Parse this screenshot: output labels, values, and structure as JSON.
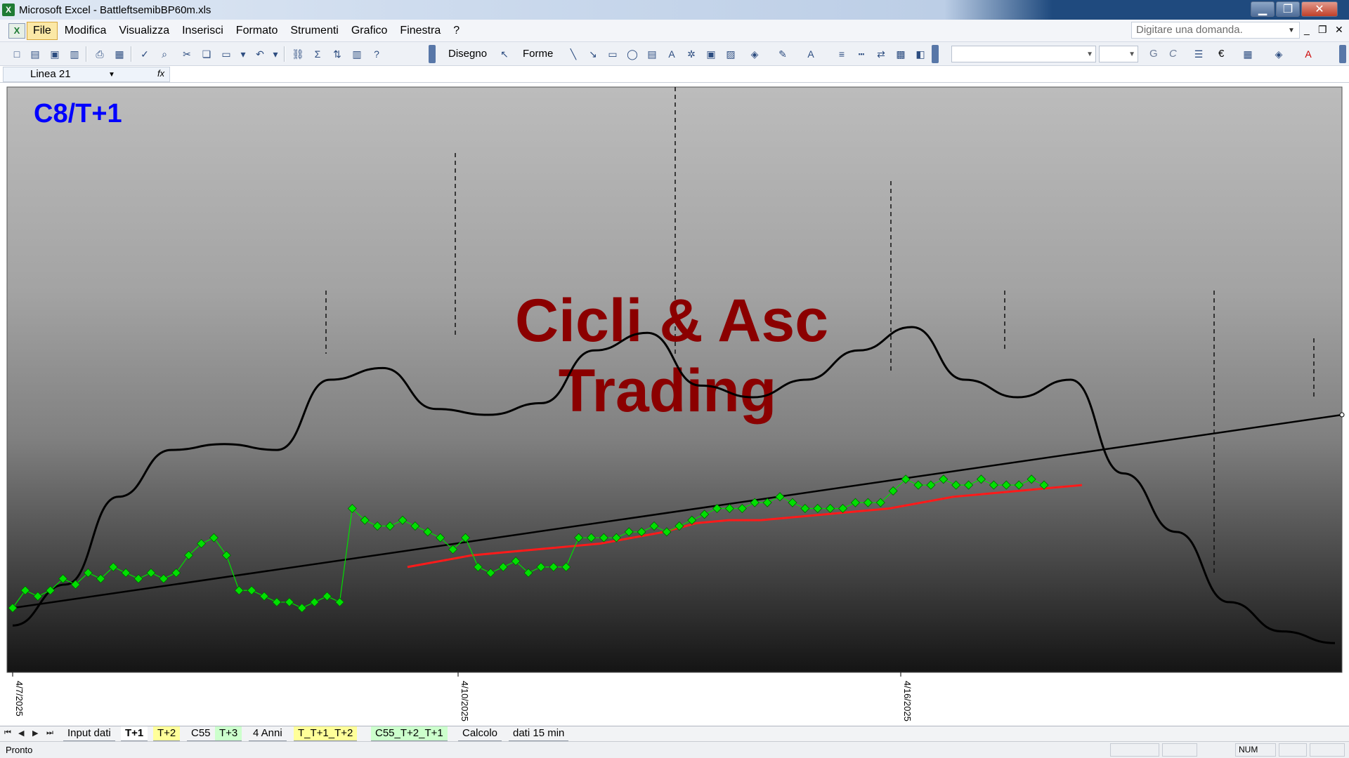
{
  "window": {
    "app_title": "Microsoft Excel - BattleftsemibBP60m.xls",
    "app_icon": "X",
    "min_label": "▁",
    "max_label": "❐",
    "close_label": "✕"
  },
  "menu": {
    "items": [
      "File",
      "Modifica",
      "Visualizza",
      "Inserisci",
      "Formato",
      "Strumenti",
      "Grafico",
      "Finestra",
      "?"
    ],
    "active_item": "File",
    "ask_placeholder": "Digitare una domanda."
  },
  "toolbar": {
    "drawing_label": "Disegno",
    "shapes_label": "Forme",
    "bold_label": "G",
    "italic_label": "C",
    "euro_label": "€"
  },
  "formula_bar": {
    "name_box": "Linea 21",
    "fx_label": "fx"
  },
  "chart": {
    "watermark_line1": "Cicli & Asc",
    "watermark_line2": "Trading",
    "label": "C8/T+1",
    "label_color": "#0000ff",
    "watermark_color": "#8b0000",
    "price_color": "#00e000",
    "ma_color": "#ff1a1a",
    "cycle_color": "#000000",
    "x_tick_labels": [
      "4/7/2025",
      "4/10/2025",
      "4/16/2025"
    ]
  },
  "chart_data": {
    "type": "line",
    "title": "C8/T+1",
    "xlabel": "",
    "ylabel": "",
    "x_ticks": [
      "4/7/2025",
      "4/10/2025",
      "4/16/2025"
    ],
    "grid": false,
    "series": [
      {
        "values": [
          0.11,
          0.14,
          0.13,
          0.14,
          0.16,
          0.15,
          0.17,
          0.16,
          0.18,
          0.17,
          0.16,
          0.17,
          0.16,
          0.17,
          0.2,
          0.22,
          0.23,
          0.2,
          0.14,
          0.14,
          0.13,
          0.12,
          0.12,
          0.11,
          0.12,
          0.13,
          0.12,
          0.28,
          0.26,
          0.25,
          0.25,
          0.26,
          0.25,
          0.24,
          0.23,
          0.21,
          0.23,
          0.18,
          0.17,
          0.18,
          0.19,
          0.17,
          0.18,
          0.18,
          0.18,
          0.23,
          0.23,
          0.23,
          0.23,
          0.24,
          0.24,
          0.25,
          0.24,
          0.25,
          0.26,
          0.27,
          0.28,
          0.28,
          0.28,
          0.29,
          0.29,
          0.3,
          0.29,
          0.28,
          0.28,
          0.28,
          0.28,
          0.29,
          0.29,
          0.29,
          0.31,
          0.33,
          0.32,
          0.32,
          0.33,
          0.32,
          0.32,
          0.33,
          0.32,
          0.32,
          0.32,
          0.33,
          0.32
        ]
      },
      {
        "values": [
          0.18,
          0.19,
          0.2,
          0.205,
          0.21,
          0.215,
          0.22,
          0.23,
          0.24,
          0.255,
          0.26,
          0.26,
          0.265,
          0.27,
          0.275,
          0.28,
          0.29,
          0.3,
          0.305,
          0.31,
          0.315,
          0.32
        ]
      },
      {
        "values": [
          0.08,
          0.15,
          0.3,
          0.38,
          0.39,
          0.38,
          0.5,
          0.52,
          0.45,
          0.44,
          0.46,
          0.55,
          0.58,
          0.49,
          0.47,
          0.5,
          0.55,
          0.59,
          0.5,
          0.47,
          0.5,
          0.34,
          0.24,
          0.12,
          0.07,
          0.05
        ]
      }
    ]
  }
}
